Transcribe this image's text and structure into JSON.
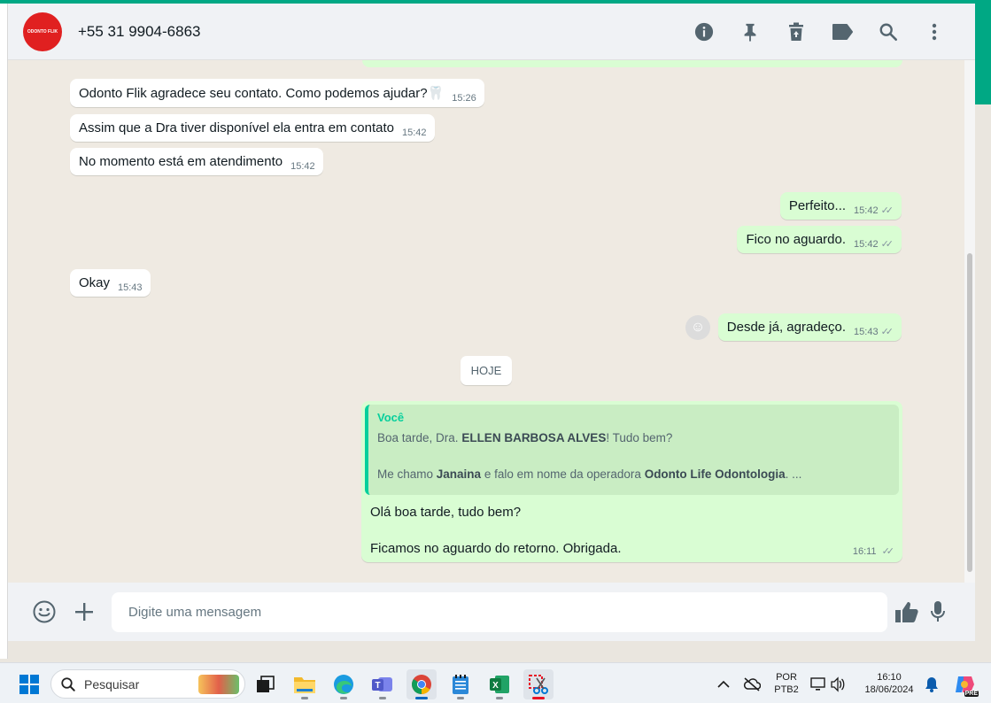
{
  "header": {
    "avatar_text": "ODONTO FLIK",
    "contact": "+55 31 9904-6863",
    "actions": [
      "info-icon",
      "pin-icon",
      "delete-icon",
      "label-icon",
      "search-icon",
      "more-icon"
    ]
  },
  "messages": [
    {
      "text": "Odonto Flik agradece seu contato. Como podemos ajudar?🦷",
      "time": "15:26",
      "dir": "in"
    },
    {
      "text": "Assim que a Dra tiver disponível ela entra em contato",
      "time": "15:42",
      "dir": "in"
    },
    {
      "text": "No momento está em atendimento",
      "time": "15:42",
      "dir": "in"
    },
    {
      "text": "Perfeito...",
      "time": "15:42",
      "dir": "out"
    },
    {
      "text": "Fico no aguardo.",
      "time": "15:42",
      "dir": "out"
    },
    {
      "text": "Okay",
      "time": "15:43",
      "dir": "in"
    },
    {
      "text": "Desde já, agradeço.",
      "time": "15:43",
      "dir": "out"
    }
  ],
  "day_chip": "HOJE",
  "reply": {
    "quote_author": "Você",
    "quote_line1_pre": "Boa tarde, Dra. ",
    "quote_line1_bold": "ELLEN BARBOSA ALVES",
    "quote_line1_post": "! Tudo bem?",
    "quote_line2_pre": "Me chamo ",
    "quote_line2_bold1": "Janaina",
    "quote_line2_mid": " e falo em nome da operadora ",
    "quote_line2_bold2": "Odonto Life Odontologia",
    "quote_line2_post": ". ...",
    "text_line1": "Olá boa tarde, tudo bem?",
    "text_line2": "Ficamos no aguardo do retorno. Obrigada.",
    "time": "16:11"
  },
  "composer": {
    "placeholder": "Digite uma mensagem"
  },
  "taskbar": {
    "search_placeholder": "Pesquisar",
    "lang_line1": "POR",
    "lang_line2": "PTB2",
    "clock_time": "16:10",
    "clock_date": "18/06/2024",
    "copilot_badge": "PRE"
  },
  "colors": {
    "accent": "#00a884",
    "outgoing": "#d9fdd3",
    "incoming": "#ffffff",
    "quote_bar": "#06cf9c"
  }
}
